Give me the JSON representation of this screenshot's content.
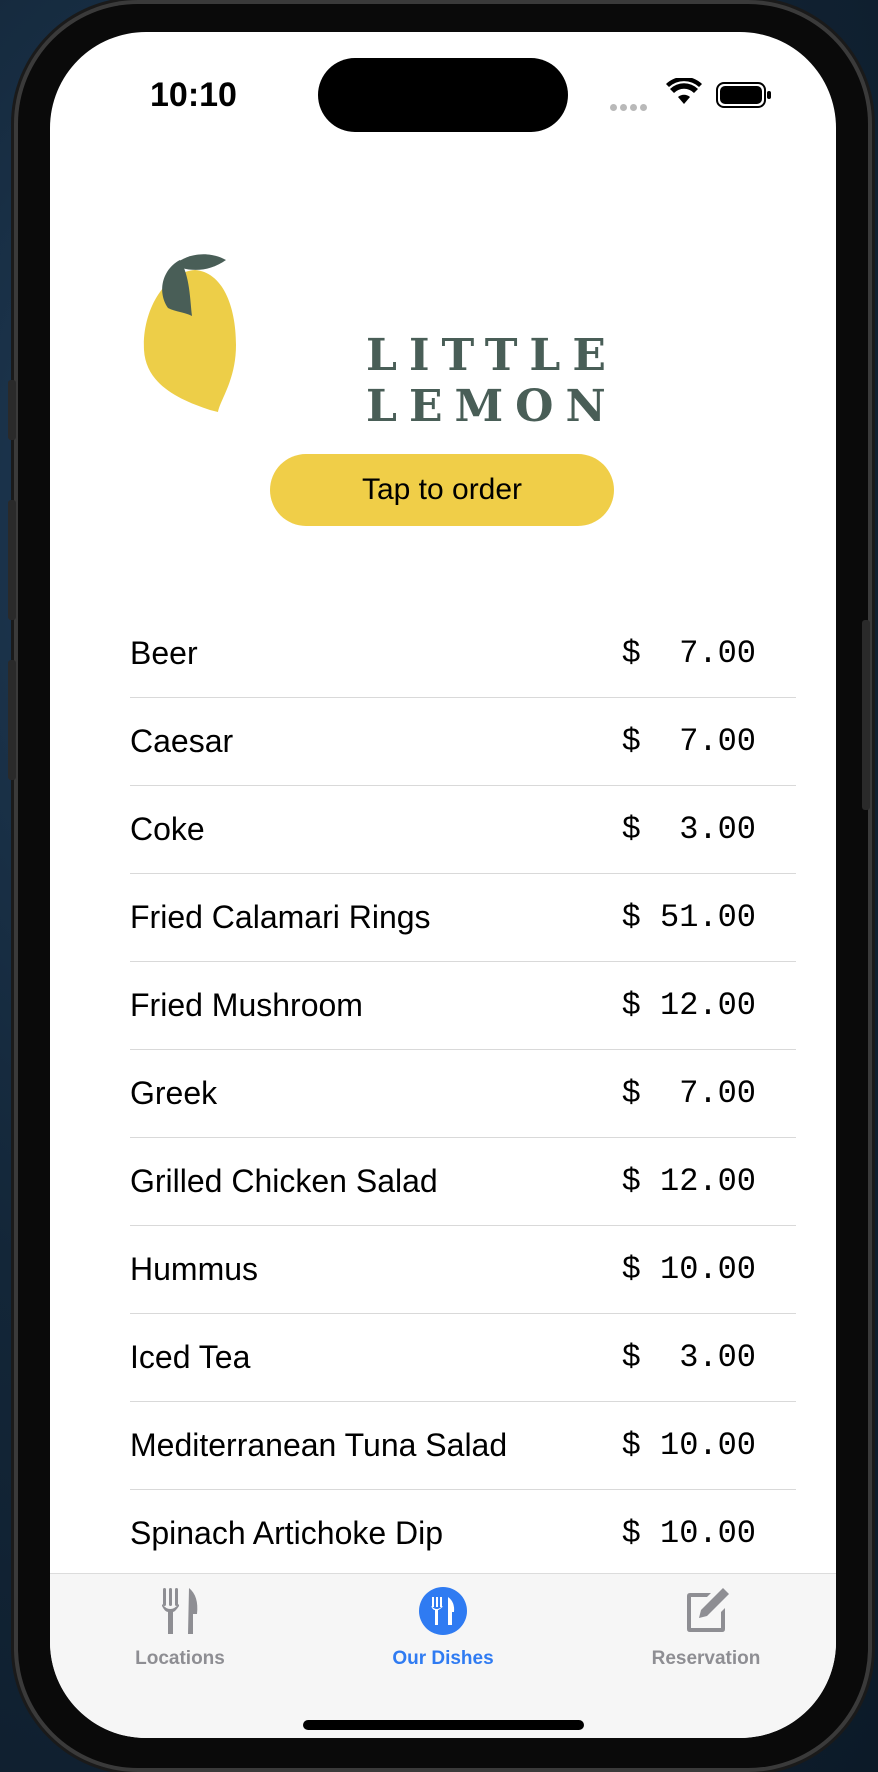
{
  "status_bar": {
    "time": "10:10"
  },
  "brand": {
    "name": "LITTLE LEMON",
    "lemon_color": "#EDCE48",
    "leaf_color": "#495E57"
  },
  "order_button": {
    "label": "Tap to order",
    "color": "#F0CE48"
  },
  "menu": {
    "items": [
      {
        "name": "Beer",
        "price": "$  7.00"
      },
      {
        "name": "Caesar",
        "price": "$  7.00"
      },
      {
        "name": "Coke",
        "price": "$  3.00"
      },
      {
        "name": "Fried Calamari Rings",
        "price": "$ 51.00"
      },
      {
        "name": "Fried Mushroom",
        "price": "$ 12.00"
      },
      {
        "name": "Greek",
        "price": "$  7.00"
      },
      {
        "name": "Grilled Chicken Salad",
        "price": "$ 12.00"
      },
      {
        "name": "Hummus",
        "price": "$ 10.00"
      },
      {
        "name": "Iced Tea",
        "price": "$  3.00"
      },
      {
        "name": "Mediterranean Tuna Salad",
        "price": "$ 10.00"
      },
      {
        "name": "Spinach Artichoke Dip",
        "price": "$ 10.00"
      }
    ]
  },
  "tab_bar": {
    "active_color": "#2F7BF2",
    "inactive_color": "#8E8E93",
    "tabs": [
      {
        "label": "Locations",
        "icon": "fork-knife-icon",
        "active": false
      },
      {
        "label": "Our Dishes",
        "icon": "fork-knife-circle-icon",
        "active": true
      },
      {
        "label": "Reservation",
        "icon": "square-pencil-icon",
        "active": false
      }
    ]
  }
}
